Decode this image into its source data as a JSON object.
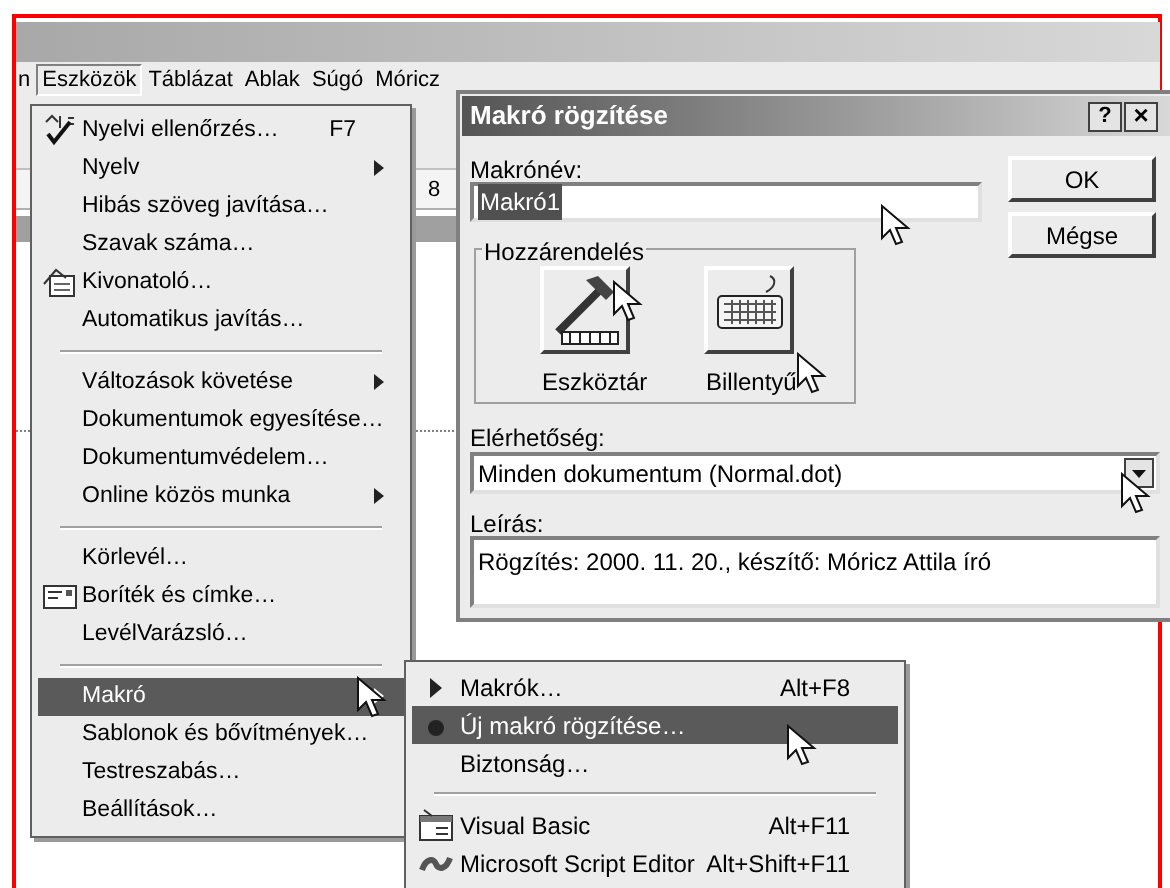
{
  "menu_bar": [
    {
      "label": "n",
      "selected": false
    },
    {
      "label": "Eszközök",
      "selected": true
    },
    {
      "label": "Táblázat",
      "selected": false
    },
    {
      "label": "Ablak",
      "selected": false
    },
    {
      "label": "Súgó",
      "selected": false
    },
    {
      "label": "Móricz",
      "selected": false
    }
  ],
  "ruler_number": "8",
  "tools_menu": [
    {
      "kind": "item",
      "label": "Nyelvi ellenőrzés…",
      "shortcut": "F7",
      "submenu": false,
      "selected": false
    },
    {
      "kind": "item",
      "label": "Nyelv",
      "submenu": true,
      "selected": false
    },
    {
      "kind": "item",
      "label": "Hibás szöveg javítása…",
      "submenu": false,
      "selected": false
    },
    {
      "kind": "item",
      "label": "Szavak száma…",
      "submenu": false,
      "selected": false
    },
    {
      "kind": "item",
      "label": "Kivonatoló…",
      "submenu": false,
      "selected": false
    },
    {
      "kind": "item",
      "label": "Automatikus javítás…",
      "submenu": false,
      "selected": false
    },
    {
      "kind": "separator"
    },
    {
      "kind": "item",
      "label": "Változások követése",
      "submenu": true,
      "selected": false
    },
    {
      "kind": "item",
      "label": "Dokumentumok egyesítése…",
      "submenu": false,
      "selected": false
    },
    {
      "kind": "item",
      "label": "Dokumentumvédelem…",
      "submenu": false,
      "selected": false
    },
    {
      "kind": "item",
      "label": "Online közös munka",
      "submenu": true,
      "selected": false
    },
    {
      "kind": "separator"
    },
    {
      "kind": "item",
      "label": "Körlevél…",
      "submenu": false,
      "selected": false
    },
    {
      "kind": "item",
      "label": "Boríték és címke…",
      "submenu": false,
      "selected": false
    },
    {
      "kind": "item",
      "label": "LevélVarázsló…",
      "submenu": false,
      "selected": false
    },
    {
      "kind": "separator"
    },
    {
      "kind": "item",
      "label": "Makró",
      "submenu": true,
      "selected": true
    },
    {
      "kind": "item",
      "label": "Sablonok és bővítmények…",
      "submenu": false,
      "selected": false
    },
    {
      "kind": "item",
      "label": "Testreszabás…",
      "submenu": false,
      "selected": false
    },
    {
      "kind": "item",
      "label": "Beállítások…",
      "submenu": false,
      "selected": false
    }
  ],
  "macro_submenu": [
    {
      "kind": "item",
      "label": "Makrók…",
      "shortcut": "Alt+F8",
      "selected": false
    },
    {
      "kind": "item",
      "label": "Új makró rögzítése…",
      "selected": true
    },
    {
      "kind": "item",
      "label": "Biztonság…",
      "selected": false
    },
    {
      "kind": "separator"
    },
    {
      "kind": "item",
      "label": "Visual Basic",
      "shortcut": "Alt+F11",
      "selected": false
    },
    {
      "kind": "item",
      "label": "Microsoft Script Editor",
      "shortcut": "Alt+Shift+F11",
      "selected": false
    }
  ],
  "dialog": {
    "title": "Makró rögzítése",
    "help_button": "?",
    "close_button": "×",
    "name_label": "Makrónév:",
    "name_value": "Makró1",
    "ok_button": "OK",
    "cancel_button": "Mégse",
    "group_title": "Hozzárendelés",
    "assign_buttons": [
      {
        "label": "Eszköztár"
      },
      {
        "label": "Billentyű"
      }
    ],
    "availability_label": "Elérhetőség:",
    "availability_value": "Minden dokumentum (Normal.dot)",
    "description_label": "Leírás:",
    "description_value": "Rögzítés: 2000. 11. 20., készítő: Móricz Attila író"
  }
}
